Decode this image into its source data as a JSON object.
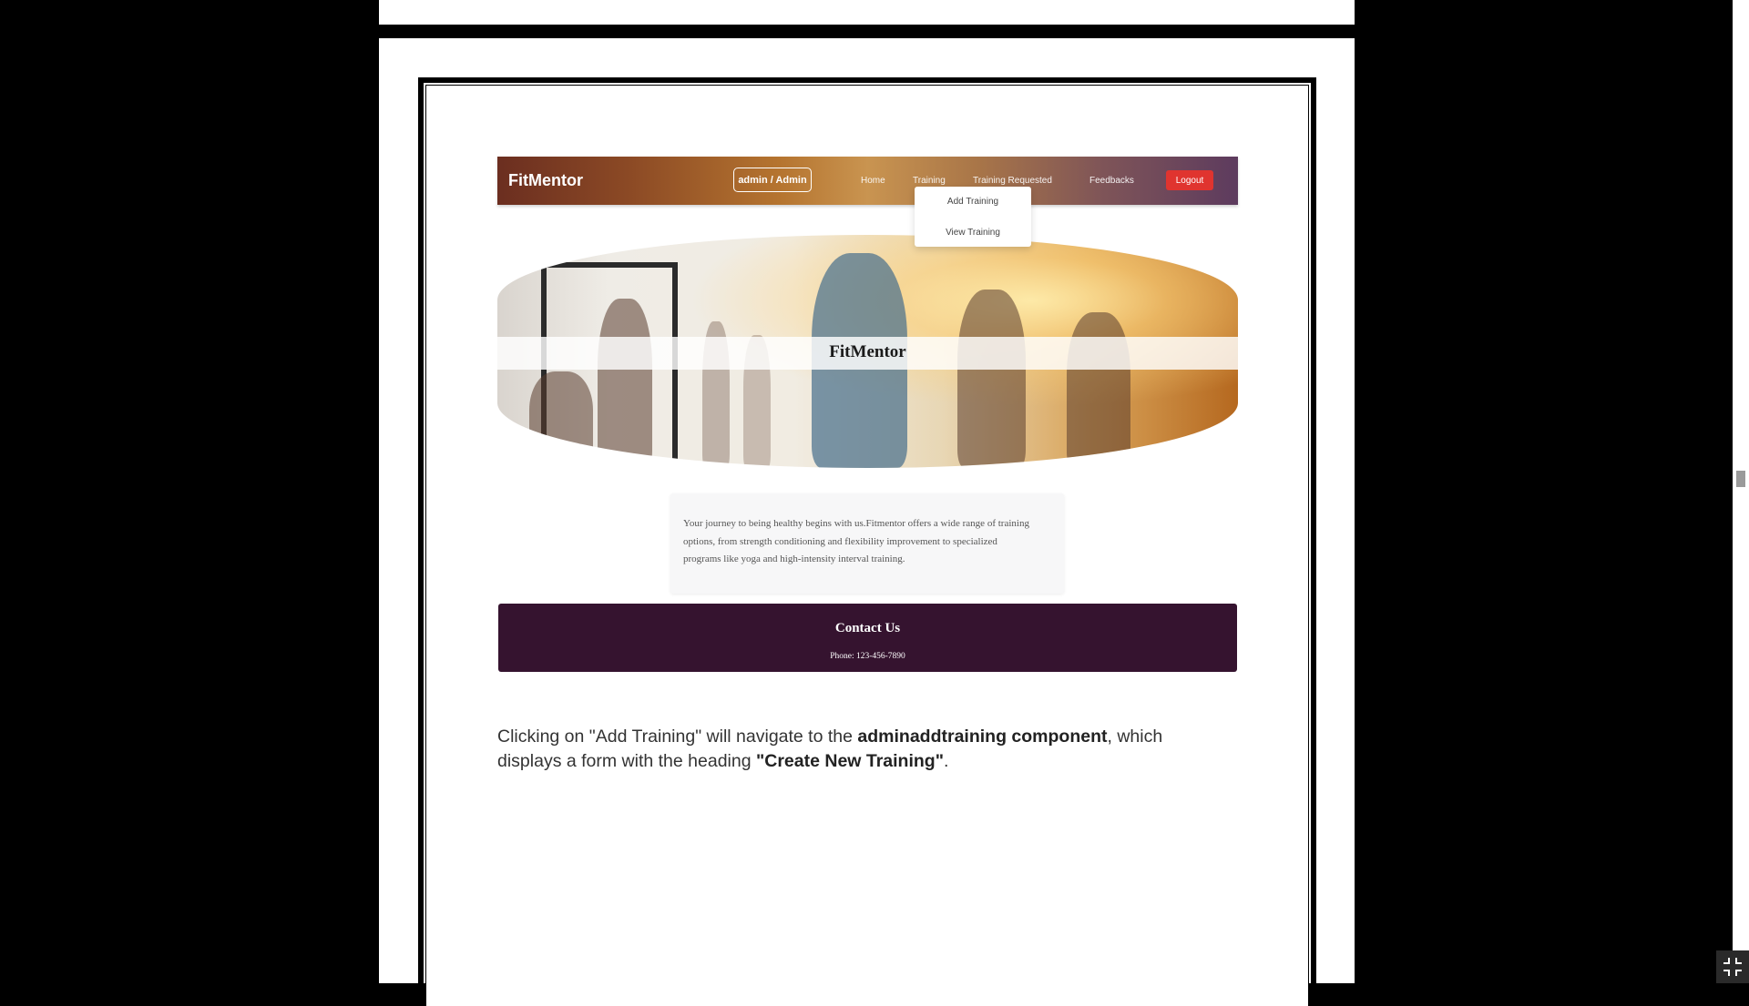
{
  "app": {
    "brand": "FitMentor",
    "user_badge": "admin / Admin",
    "nav": {
      "home": "Home",
      "training": "Training",
      "training_requested": "Training Requested",
      "feedbacks": "Feedbacks",
      "logout": "Logout"
    },
    "dropdown": {
      "add_training": "Add Training",
      "view_training": "View Training"
    },
    "hero_title": "FitMentor",
    "about": "Your journey to being healthy begins with us.Fitmentor offers a wide range of training options, from strength conditioning and flexibility improvement to specialized programs like yoga and high-intensity interval training.",
    "contact": {
      "title": "Contact Us",
      "phone": "Phone: 123-456-7890"
    }
  },
  "caption": {
    "part1": "Clicking on \"Add Training\" will navigate to the ",
    "bold1": "adminaddtraining component",
    "part2": ", which displays a form with the heading ",
    "bold2": "\"Create New Training\"",
    "part3": "."
  },
  "colors": {
    "logout": "#e0342f",
    "contact_bg": "#35132f",
    "page_bg": "#000000"
  },
  "icons": {
    "fullscreen": "exit-fullscreen-icon"
  }
}
